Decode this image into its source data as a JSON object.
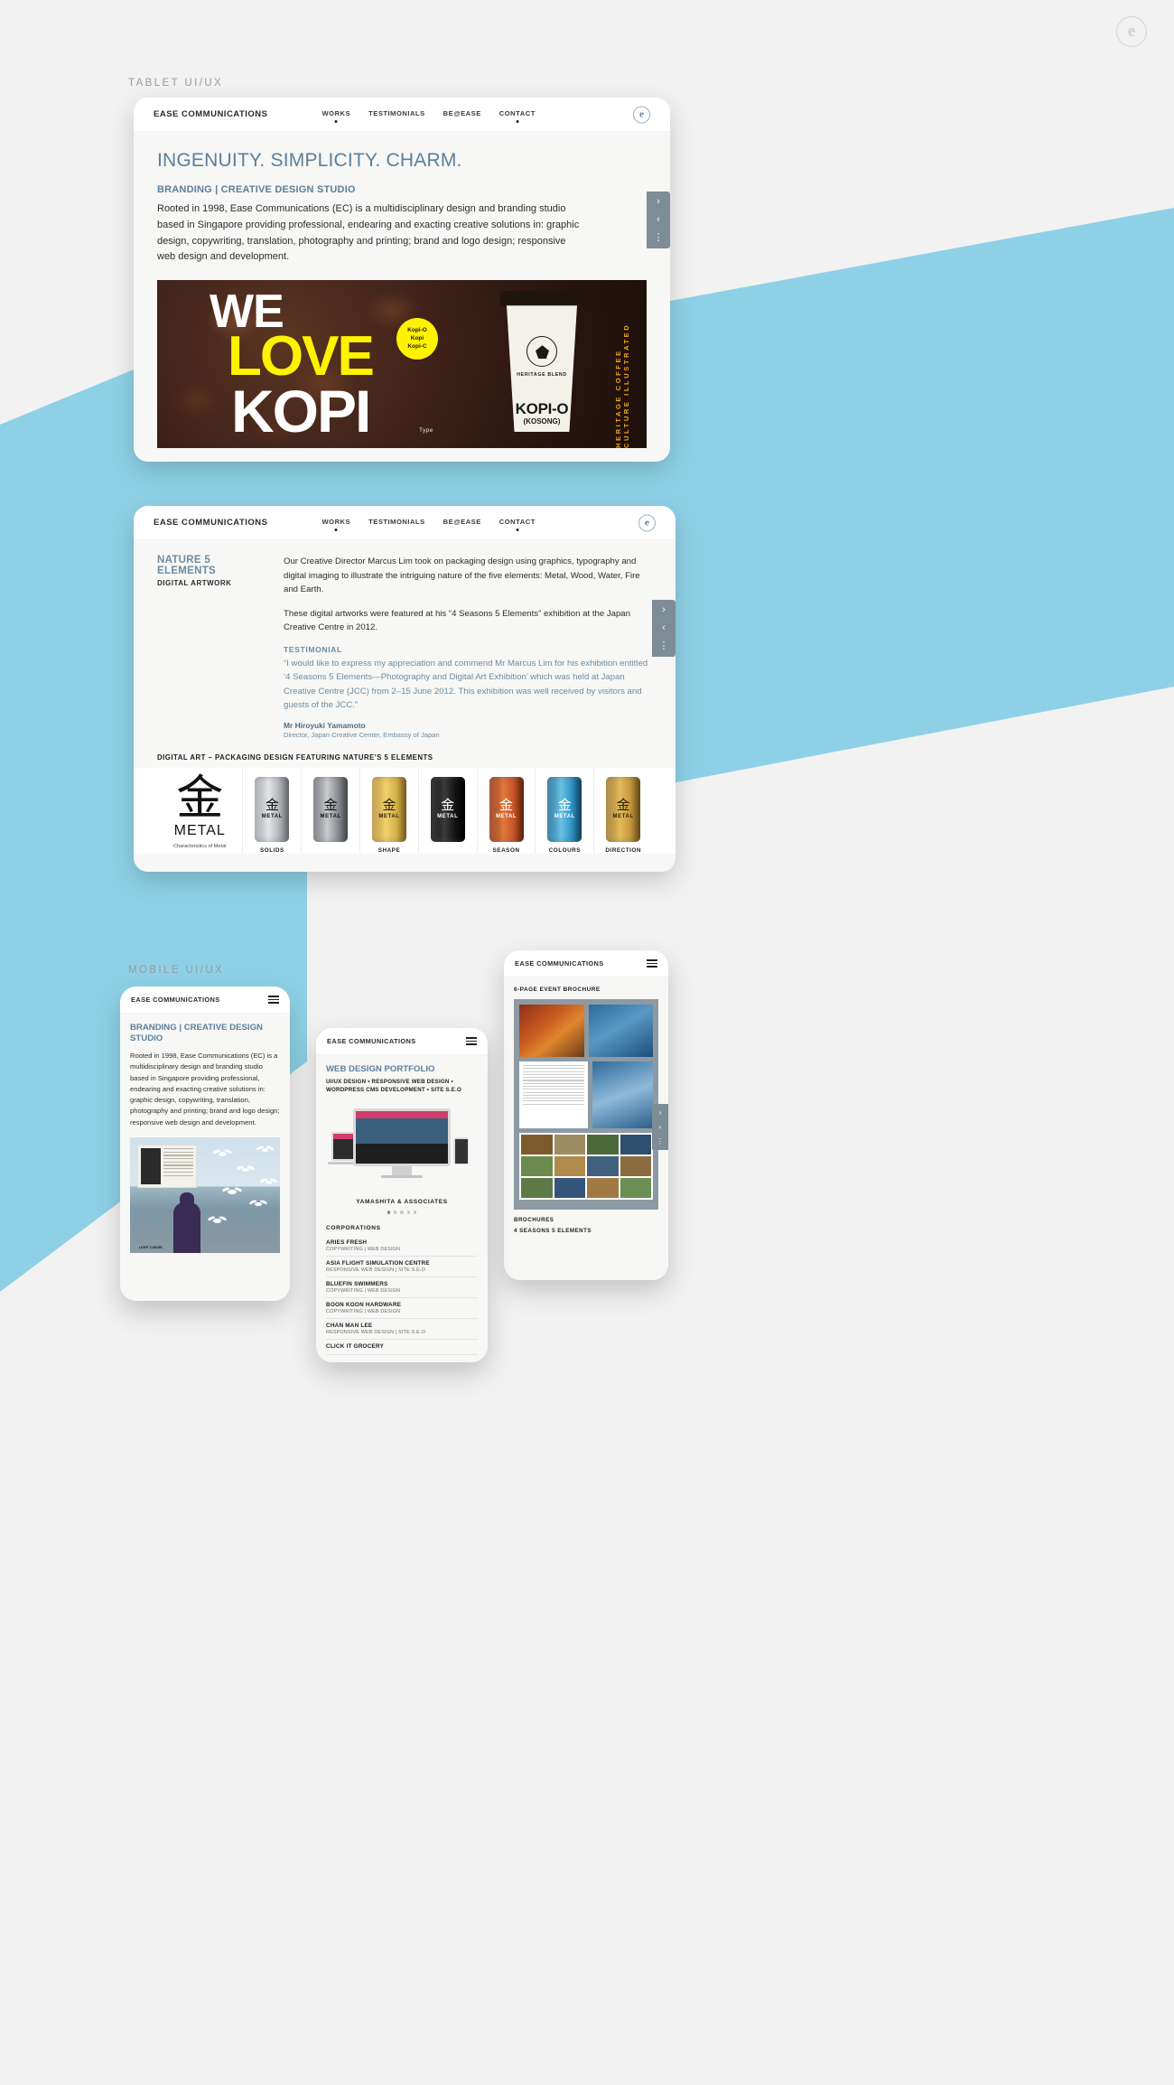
{
  "brand": {
    "mark": "e"
  },
  "sections": [
    {
      "id": "tablet",
      "label": "TABLET UI/UX"
    },
    {
      "id": "mobile",
      "label": "MOBILE UI/UX"
    }
  ],
  "nav": {
    "logo": "EASE COMMUNICATIONS",
    "items": [
      "WORKS",
      "TESTIMONIALS",
      "BE@EASE",
      "CONTACT"
    ],
    "mark": "e"
  },
  "pager": {
    "next": "›",
    "prev": "‹",
    "more": "⋮"
  },
  "tablet_one": {
    "headline": "INGENUITY. SIMPLICITY. CHARM.",
    "subhead": "BRANDING | CREATIVE DESIGN STUDIO",
    "body": "Rooted in 1998, Ease Communications (EC) is a multidisciplinary design and branding studio based in Singapore providing professional, endearing and exacting creative solutions in: graphic design, copywriting, translation, photography and printing; brand and logo design; responsive web design and development.",
    "hero": {
      "line1": "WE",
      "line2": "LOVE",
      "line3": "KOPI",
      "badge": [
        "Kopi-O",
        "Kopi",
        "Kopi-C"
      ],
      "cup_brand": "HERITAGE BLEND",
      "cup_name": "KOPI-O",
      "cup_variant": "(KOSONG)",
      "vertical_strip": "HERITAGE  COFFEE  CULTURE  ILLUSTRATED",
      "type_credit": "Type"
    }
  },
  "tablet_two": {
    "project_title": "NATURE 5 ELEMENTS",
    "project_sub": "DIGITAL ARTWORK",
    "paragraphs": [
      "Our Creative Director Marcus Lim took on packaging design using graphics, typography and digital imaging to illustrate the intriguing nature of the five elements: Metal, Wood, Water, Fire and Earth.",
      "These digital artworks were featured at his “4 Seasons 5 Elements” exhibition at the Japan Creative Centre in 2012."
    ],
    "testimonial": {
      "label": "TESTIMONIAL",
      "quote": "“I would like to express my appreciation and commend Mr Marcus Lim for his exhibition entitled ‘4 Seasons 5 Elements—Photography and Digital Art Exhibition’ which was held at Japan Creative Centre (JCC) from 2–15 June 2012. This exhibition was well received by visitors and guests of the JCC.”",
      "name": "Mr Hiroyuki Yamamoto",
      "role": "Director, Japan Creative Center, Embassy of Japan"
    },
    "gallery_caption": "DIGITAL ART – PACKAGING DESIGN FEATURING NATURE'S 5 ELEMENTS",
    "gallery": [
      {
        "kanji": "金",
        "word": "METAL",
        "caption": "Characteristics of Metal",
        "label": "",
        "type": "poster",
        "color": ""
      },
      {
        "kanji": "金",
        "word": "METAL",
        "caption": "",
        "label": "SOLIDS",
        "type": "can",
        "color": "#b9bcc0"
      },
      {
        "kanji": "金",
        "word": "METAL",
        "caption": "",
        "label": "",
        "type": "can",
        "color": "#8d9196"
      },
      {
        "kanji": "金",
        "word": "METAL",
        "caption": "",
        "label": "SHAPE",
        "type": "can",
        "color": "#d8b24a"
      },
      {
        "kanji": "金",
        "word": "METAL",
        "caption": "",
        "label": "",
        "type": "can",
        "color": "#151515"
      },
      {
        "kanji": "金",
        "word": "METAL",
        "caption": "",
        "label": "SEASON",
        "type": "can",
        "color": "#c8552a"
      },
      {
        "kanji": "金",
        "word": "METAL",
        "caption": "",
        "label": "COLOURS",
        "type": "can",
        "color": "#2f96c8"
      },
      {
        "kanji": "金",
        "word": "METAL",
        "caption": "",
        "label": "DIRECTION",
        "type": "can",
        "color": "#c79a3c"
      }
    ]
  },
  "phone_left": {
    "logo": "EASE COMMUNICATIONS",
    "heading": "BRANDING | CREATIVE DESIGN STUDIO",
    "body": "Rooted in 1998, Ease Communications (EC) is a multidisciplinary design and branding studio based in Singapore providing professional, endearing and exacting creative solutions in: graphic design, copywriting, translation, photography and printing; brand and logo design; responsive web design and development.",
    "photo_caption": "LIGHT CARVEL"
  },
  "phone_center": {
    "logo": "EASE COMMUNICATIONS",
    "heading": "WEB DESIGN PORTFOLIO",
    "subheading": "UI/UX DESIGN • RESPONSIVE WEB DESIGN • WORDPRESS CMS DEVELOPMENT • SITE S.E.O",
    "carousel_title": "YAMASHITA & ASSOCIATES",
    "dots": 5,
    "active_dot": 0,
    "corporations_heading": "CORPORATIONS",
    "corporations": [
      {
        "name": "ARIES FRESH",
        "services": "COPYWRITING | WEB DESIGN"
      },
      {
        "name": "ASIA FLIGHT SIMULATION CENTRE",
        "services": "RESPONSIVE WEB DESIGN | SITE S.E.O"
      },
      {
        "name": "BLUEFIN SWIMMERS",
        "services": "COPYWRITING | WEB DESIGN"
      },
      {
        "name": "BOON KOON HARDWARE",
        "services": "COPYWRITING | WEB DESIGN"
      },
      {
        "name": "CHAN MAN LEE",
        "services": "RESPONSIVE WEB DESIGN | SITE S.E.O"
      },
      {
        "name": "CLICK IT GROCERY",
        "services": ""
      }
    ]
  },
  "phone_right": {
    "logo": "EASE COMMUNICATIONS",
    "heading": "6-PAGE EVENT BROCHURE",
    "footer_label": "BROCHURES",
    "footer_label_2": "4 SEASONS 5 ELEMENTS"
  },
  "colors": {
    "accent_blue": "#8ed1e6",
    "text_blue": "#5b7f9b",
    "page_bg": "#f2f2f2",
    "pager_grey": "#7e8c95",
    "highlight_yellow": "#fff200"
  }
}
